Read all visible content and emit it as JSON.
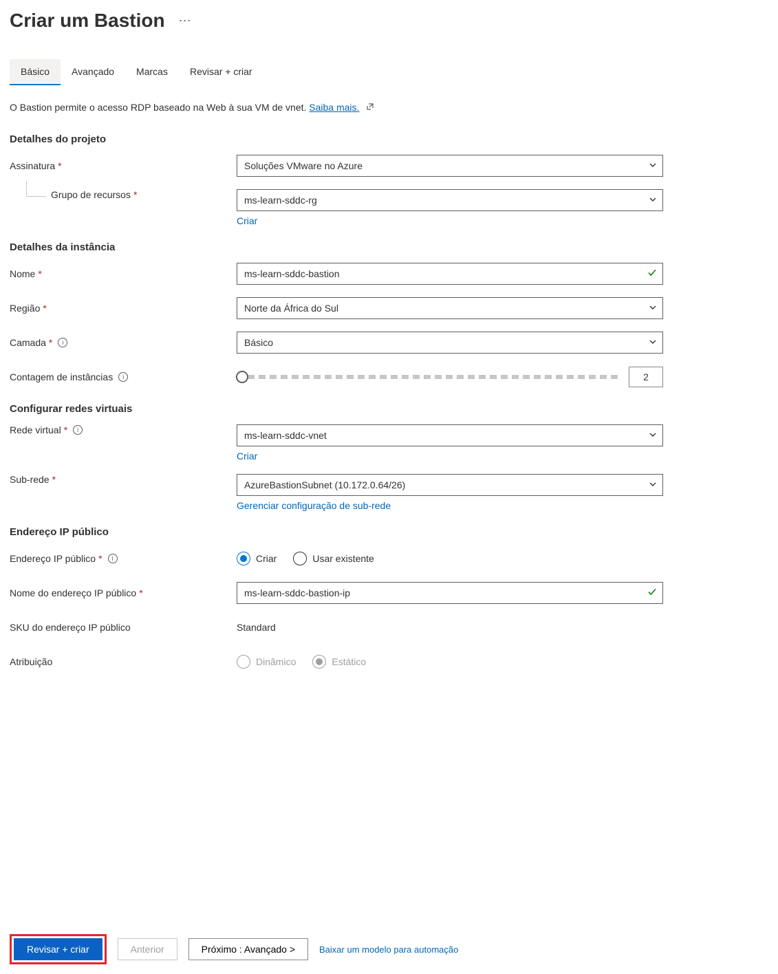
{
  "header": {
    "title": "Criar um Bastion"
  },
  "tabs": {
    "basic": "Básico",
    "advanced": "Avançado",
    "tags": "Marcas",
    "review": "Revisar + criar"
  },
  "intro": {
    "text": "O Bastion permite o acesso RDP baseado na Web à sua VM de vnet. ",
    "link": "Saiba mais."
  },
  "sections": {
    "project": "Detalhes do projeto",
    "instance": "Detalhes da instância",
    "vnet": "Configurar redes virtuais",
    "publicip": "Endereço IP público"
  },
  "labels": {
    "subscription": "Assinatura",
    "resource_group": "Grupo de recursos",
    "name": "Nome",
    "region": "Região",
    "tier": "Camada",
    "instance_count": "Contagem de instâncias",
    "virtual_network": "Rede virtual",
    "subnet": "Sub-rede",
    "public_ip": "Endereço IP público",
    "public_ip_name": "Nome do endereço IP público",
    "public_ip_sku": "SKU do endereço IP público",
    "assignment": "Atribuição"
  },
  "values": {
    "subscription": "Soluções VMware no Azure",
    "resource_group": "ms-learn-sddc-rg",
    "name": "ms-learn-sddc-bastion",
    "region": "Norte da África do Sul",
    "tier": "Básico",
    "instance_count": "2",
    "virtual_network": "ms-learn-sddc-vnet",
    "subnet": "AzureBastionSubnet (10.172.0.64/26)",
    "public_ip_name": "ms-learn-sddc-bastion-ip",
    "public_ip_sku": "Standard"
  },
  "links": {
    "create_rg": "Criar",
    "create_vnet": "Criar",
    "manage_subnet": "Gerenciar configuração de sub-rede"
  },
  "radios": {
    "public_ip_create": "Criar",
    "public_ip_existing": "Usar existente",
    "assign_dynamic": "Dinâmico",
    "assign_static": "Estático"
  },
  "footer": {
    "review_create": "Revisar + criar",
    "previous": "Anterior",
    "next": "Próximo : Avançado >",
    "download": "Baixar um modelo para automação"
  }
}
